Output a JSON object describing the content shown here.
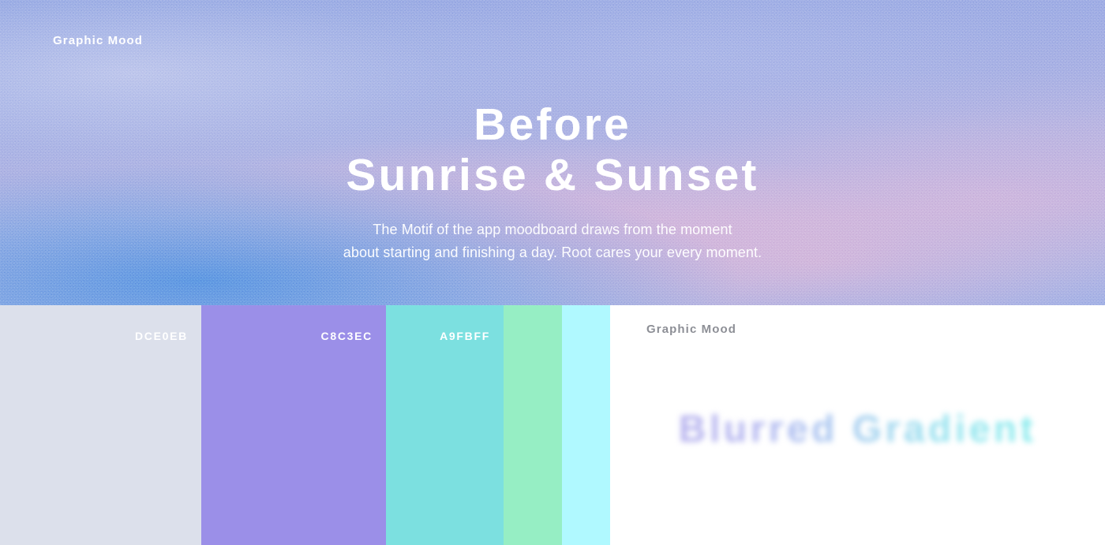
{
  "hero": {
    "brand_label": "Graphic Mood",
    "title_line1": "Before",
    "title_line2": "Sunrise & Sunset",
    "subtitle_line1": "The Motif of  the app moodboard draws from  the moment",
    "subtitle_line2": "about starting and finishing a day. Root cares  your every moment.",
    "gradient_colors": {
      "periwinkle": "#93A6E2",
      "lavender": "#B8B3E0",
      "pink_haze": "#E8B7D8",
      "sky_blue": "#5696E2"
    }
  },
  "palette": {
    "swatches": [
      {
        "name": "gray-blue",
        "label": "DCE0EB",
        "hex": "#DCE0EB",
        "label_visible": true
      },
      {
        "name": "periwinkle",
        "label": "C8C3EC",
        "hex": "#9B8FE8",
        "label_visible": true
      },
      {
        "name": "turquoise",
        "label": "A9FBFF",
        "hex": "#7CE0E0",
        "label_visible": true
      },
      {
        "name": "mint",
        "label": "",
        "hex": "#96EEC4",
        "label_visible": false
      },
      {
        "name": "ice-cyan",
        "label": "",
        "hex": "#B0F9FF",
        "label_visible": false
      }
    ]
  },
  "panel": {
    "brand_label": "Graphic Mood",
    "brand_color": "#8D8F96",
    "blurred_text": "Blurred  Gradient",
    "gradient_start": "#B7B2EE",
    "gradient_end": "#8AECED"
  }
}
